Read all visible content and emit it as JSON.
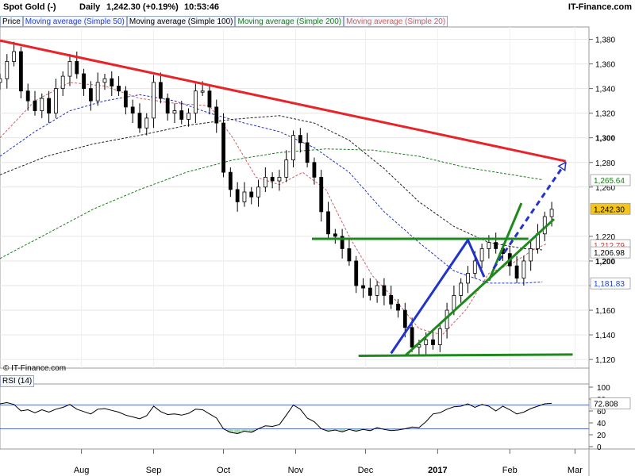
{
  "header": {
    "instrument": "Spot Gold (-)",
    "period": "Daily",
    "price_change": "1,242.30 (+0.19%)",
    "time": "10:53:46",
    "brand": "IT-Finance.com"
  },
  "legend": [
    {
      "label": "Price",
      "color": "#000000"
    },
    {
      "label": "Moving average (Simple 50)",
      "color": "#1f3fcf"
    },
    {
      "label": "Moving average (Simple 100)",
      "color": "#000000"
    },
    {
      "label": "Moving average (Simple 200)",
      "color": "#1e7a1e"
    },
    {
      "label": "Moving average (Simple 20)",
      "color": "#d06060"
    }
  ],
  "copyright": "© IT-Finance.com",
  "rsi_label": "RSI (14)",
  "chart_data": {
    "type": "candlestick",
    "x_ticks": [
      {
        "label": "Aug",
        "day": 35,
        "bold": false
      },
      {
        "label": "Sep",
        "day": 66,
        "bold": false
      },
      {
        "label": "Oct",
        "day": 96,
        "bold": false
      },
      {
        "label": "Nov",
        "day": 127,
        "bold": false
      },
      {
        "label": "Dec",
        "day": 157,
        "bold": false
      },
      {
        "label": "2017",
        "day": 188,
        "bold": true
      },
      {
        "label": "Feb",
        "day": 219,
        "bold": false
      },
      {
        "label": "Mar",
        "day": 247,
        "bold": false
      }
    ],
    "x_range": [
      0,
      253
    ],
    "price_axis": {
      "range": [
        1113,
        1390
      ],
      "ticks": [
        "1,380",
        "1,360",
        "1,340",
        "1,320",
        "1,300",
        "1,280",
        "1,260",
        "1,220",
        "1,200",
        "1,180",
        "1,160",
        "1,140",
        "1,120"
      ],
      "bold_ticks": [
        "1,300",
        "1,200"
      ]
    },
    "price_labels": [
      {
        "text": "1,265.64",
        "value": 1265.64,
        "color": "#1e7a1e",
        "bg": "#ffffff"
      },
      {
        "text": "1,242.30",
        "value": 1242.3,
        "color": "#000000",
        "bg": "#f5c518"
      },
      {
        "text": "1,212.79",
        "value": 1212.79,
        "color": "#c04040",
        "bg": "#ffffff"
      },
      {
        "text": "1,206.98",
        "value": 1206.98,
        "color": "#000000",
        "bg": "#ffffff"
      },
      {
        "text": "1,181.83",
        "value": 1181.83,
        "color": "#1f3fcf",
        "bg": "#ffffff"
      }
    ],
    "closes": [
      [
        0,
        1348
      ],
      [
        3,
        1362
      ],
      [
        6,
        1370
      ],
      [
        9,
        1338
      ],
      [
        12,
        1330
      ],
      [
        15,
        1322
      ],
      [
        18,
        1332
      ],
      [
        21,
        1320
      ],
      [
        24,
        1340
      ],
      [
        27,
        1350
      ],
      [
        30,
        1362
      ],
      [
        33,
        1352
      ],
      [
        36,
        1340
      ],
      [
        39,
        1330
      ],
      [
        42,
        1345
      ],
      [
        45,
        1348
      ],
      [
        48,
        1342
      ],
      [
        51,
        1338
      ],
      [
        54,
        1325
      ],
      [
        57,
        1320
      ],
      [
        60,
        1308
      ],
      [
        63,
        1316
      ],
      [
        66,
        1345
      ],
      [
        69,
        1332
      ],
      [
        72,
        1320
      ],
      [
        75,
        1322
      ],
      [
        78,
        1315
      ],
      [
        81,
        1320
      ],
      [
        84,
        1338
      ],
      [
        87,
        1338
      ],
      [
        90,
        1325
      ],
      [
        93,
        1312
      ],
      [
        96,
        1272
      ],
      [
        99,
        1258
      ],
      [
        102,
        1248
      ],
      [
        105,
        1256
      ],
      [
        108,
        1252
      ],
      [
        111,
        1260
      ],
      [
        114,
        1268
      ],
      [
        117,
        1265
      ],
      [
        120,
        1268
      ],
      [
        123,
        1282
      ],
      [
        126,
        1302
      ],
      [
        129,
        1296
      ],
      [
        132,
        1280
      ],
      [
        135,
        1268
      ],
      [
        138,
        1240
      ],
      [
        141,
        1222
      ],
      [
        144,
        1220
      ],
      [
        147,
        1210
      ],
      [
        150,
        1200
      ],
      [
        153,
        1180
      ],
      [
        156,
        1178
      ],
      [
        159,
        1172
      ],
      [
        162,
        1180
      ],
      [
        165,
        1172
      ],
      [
        168,
        1165
      ],
      [
        171,
        1160
      ],
      [
        174,
        1146
      ],
      [
        177,
        1130
      ],
      [
        180,
        1132
      ],
      [
        183,
        1136
      ],
      [
        186,
        1132
      ],
      [
        189,
        1145
      ],
      [
        192,
        1160
      ],
      [
        195,
        1172
      ],
      [
        198,
        1182
      ],
      [
        201,
        1190
      ],
      [
        204,
        1200
      ],
      [
        207,
        1210
      ],
      [
        210,
        1215
      ],
      [
        213,
        1210
      ],
      [
        216,
        1206
      ],
      [
        219,
        1196
      ],
      [
        222,
        1186
      ],
      [
        225,
        1200
      ],
      [
        228,
        1210
      ],
      [
        231,
        1222
      ],
      [
        234,
        1236
      ],
      [
        237,
        1242
      ]
    ],
    "moving_averages": [
      {
        "name": "Moving average (Simple 50)",
        "color": "#2233cc",
        "points": [
          [
            0,
            1285
          ],
          [
            15,
            1305
          ],
          [
            30,
            1322
          ],
          [
            45,
            1330
          ],
          [
            60,
            1335
          ],
          [
            75,
            1330
          ],
          [
            90,
            1320
          ],
          [
            105,
            1312
          ],
          [
            120,
            1305
          ],
          [
            135,
            1292
          ],
          [
            150,
            1272
          ],
          [
            165,
            1240
          ],
          [
            180,
            1215
          ],
          [
            195,
            1192
          ],
          [
            210,
            1182
          ],
          [
            225,
            1182
          ],
          [
            233,
            1183
          ]
        ]
      },
      {
        "name": "Moving average (Simple 100)",
        "color": "#222222",
        "points": [
          [
            0,
            1270
          ],
          [
            20,
            1285
          ],
          [
            40,
            1295
          ],
          [
            60,
            1302
          ],
          [
            80,
            1310
          ],
          [
            100,
            1315
          ],
          [
            120,
            1318
          ],
          [
            135,
            1312
          ],
          [
            150,
            1298
          ],
          [
            165,
            1275
          ],
          [
            180,
            1248
          ],
          [
            195,
            1228
          ],
          [
            210,
            1215
          ],
          [
            225,
            1210
          ],
          [
            233,
            1209
          ]
        ]
      },
      {
        "name": "Moving average (Simple 200)",
        "color": "#1e7a1e",
        "points": [
          [
            0,
            1202
          ],
          [
            20,
            1222
          ],
          [
            40,
            1242
          ],
          [
            60,
            1258
          ],
          [
            80,
            1272
          ],
          [
            100,
            1282
          ],
          [
            120,
            1288
          ],
          [
            140,
            1291
          ],
          [
            160,
            1290
          ],
          [
            180,
            1285
          ],
          [
            200,
            1276
          ],
          [
            220,
            1270
          ],
          [
            233,
            1266
          ]
        ]
      },
      {
        "name": "Moving average (Simple 20)",
        "color": "#d06060",
        "points": [
          [
            0,
            1300
          ],
          [
            15,
            1330
          ],
          [
            30,
            1345
          ],
          [
            45,
            1342
          ],
          [
            60,
            1332
          ],
          [
            75,
            1328
          ],
          [
            90,
            1326
          ],
          [
            100,
            1300
          ],
          [
            110,
            1268
          ],
          [
            120,
            1262
          ],
          [
            130,
            1272
          ],
          [
            140,
            1258
          ],
          [
            150,
            1220
          ],
          [
            160,
            1188
          ],
          [
            170,
            1168
          ],
          [
            180,
            1145
          ],
          [
            190,
            1140
          ],
          [
            200,
            1160
          ],
          [
            210,
            1190
          ],
          [
            220,
            1198
          ],
          [
            230,
            1210
          ],
          [
            235,
            1214
          ]
        ]
      }
    ],
    "trendlines": [
      {
        "points": [
          [
            0,
            1379
          ],
          [
            243,
            1281
          ]
        ],
        "color": "#e8242a",
        "dashed": false,
        "arrow": false
      },
      {
        "points": [
          [
            134,
            1218
          ],
          [
            227,
            1218
          ]
        ],
        "color": "#1e8a1e",
        "dashed": false,
        "arrow": false
      },
      {
        "points": [
          [
            154,
            1123
          ],
          [
            246,
            1124
          ]
        ],
        "color": "#1e8a1e",
        "dashed": false,
        "arrow": false
      },
      {
        "points": [
          [
            174,
            1123
          ],
          [
            238,
            1234
          ]
        ],
        "color": "#1e8a1e",
        "dashed": false,
        "arrow": false
      },
      {
        "points": [
          [
            210,
            1184
          ],
          [
            224,
            1247
          ]
        ],
        "color": "#1e8a1e",
        "dashed": false,
        "arrow": false
      },
      {
        "points": [
          [
            168,
            1125
          ],
          [
            201,
            1217
          ],
          [
            208,
            1187
          ]
        ],
        "color": "#2233cc",
        "dashed": false,
        "arrow": false
      },
      {
        "points": [
          [
            212,
            1194
          ],
          [
            243,
            1280
          ]
        ],
        "color": "#2233cc",
        "dashed": true,
        "arrow": true
      }
    ],
    "rsi": {
      "range": [
        0,
        100
      ],
      "ticks": [
        100,
        80,
        60,
        40,
        20,
        0
      ],
      "levels": [
        70,
        30
      ],
      "last": 72.808,
      "values": [
        [
          0,
          72
        ],
        [
          3,
          74
        ],
        [
          6,
          71
        ],
        [
          9,
          60
        ],
        [
          12,
          62
        ],
        [
          15,
          57
        ],
        [
          18,
          62
        ],
        [
          21,
          58
        ],
        [
          24,
          63
        ],
        [
          27,
          66
        ],
        [
          30,
          71
        ],
        [
          33,
          63
        ],
        [
          36,
          59
        ],
        [
          39,
          55
        ],
        [
          42,
          63
        ],
        [
          45,
          64
        ],
        [
          48,
          61
        ],
        [
          51,
          58
        ],
        [
          54,
          53
        ],
        [
          57,
          50
        ],
        [
          60,
          47
        ],
        [
          63,
          52
        ],
        [
          66,
          68
        ],
        [
          69,
          59
        ],
        [
          72,
          54
        ],
        [
          75,
          55
        ],
        [
          78,
          53
        ],
        [
          81,
          56
        ],
        [
          84,
          63
        ],
        [
          87,
          62
        ],
        [
          90,
          55
        ],
        [
          93,
          48
        ],
        [
          96,
          30
        ],
        [
          99,
          24
        ],
        [
          102,
          22
        ],
        [
          105,
          26
        ],
        [
          108,
          24
        ],
        [
          111,
          30
        ],
        [
          114,
          35
        ],
        [
          117,
          34
        ],
        [
          120,
          37
        ],
        [
          123,
          53
        ],
        [
          126,
          70
        ],
        [
          129,
          63
        ],
        [
          132,
          48
        ],
        [
          135,
          42
        ],
        [
          138,
          30
        ],
        [
          141,
          26
        ],
        [
          144,
          28
        ],
        [
          147,
          25
        ],
        [
          150,
          29
        ],
        [
          153,
          26
        ],
        [
          156,
          29
        ],
        [
          159,
          27
        ],
        [
          162,
          32
        ],
        [
          165,
          29
        ],
        [
          168,
          27
        ],
        [
          171,
          28
        ],
        [
          174,
          30
        ],
        [
          177,
          33
        ],
        [
          180,
          32
        ],
        [
          183,
          42
        ],
        [
          186,
          55
        ],
        [
          189,
          57
        ],
        [
          192,
          63
        ],
        [
          195,
          67
        ],
        [
          198,
          68
        ],
        [
          201,
          72
        ],
        [
          204,
          66
        ],
        [
          207,
          71
        ],
        [
          210,
          68
        ],
        [
          213,
          60
        ],
        [
          216,
          68
        ],
        [
          219,
          62
        ],
        [
          222,
          55
        ],
        [
          225,
          58
        ],
        [
          228,
          64
        ],
        [
          231,
          68
        ],
        [
          234,
          72
        ],
        [
          237,
          72.8
        ]
      ]
    }
  }
}
